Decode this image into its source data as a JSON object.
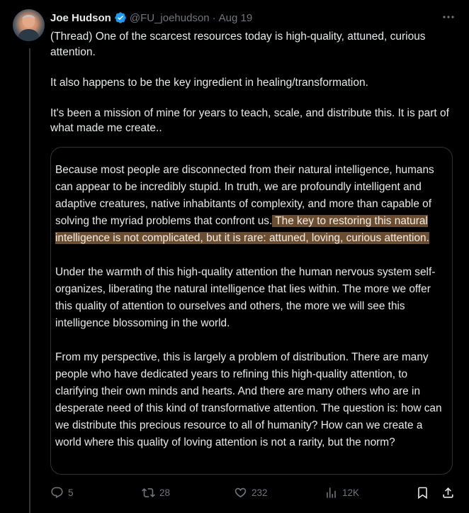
{
  "author": {
    "display_name": "Joe Hudson",
    "handle": "@FU_joehudson",
    "date": "Aug 19",
    "separator": "·"
  },
  "tweet": {
    "paragraphs": [
      "(Thread) One of the scarcest resources today is high-quality, attuned, curious attention.",
      "It also happens to be the key ingredient in healing/transformation.",
      "It's been a mission of mine for years to teach, scale, and distribute this. It is part of what made me create.."
    ]
  },
  "quote": {
    "p1_plain": "Because most people are disconnected from their natural intelligence, humans can appear to be incredibly stupid. In truth, we are profoundly intelligent and adaptive creatures, native inhabitants of complexity, and more than capable of solving the myriad problems that confront us.",
    "p1_highlight": " The key to restoring this natural intelligence is not complicated, but it is rare: attuned, loving, curious attention.",
    "p2": "Under the warmth of this high-quality attention the human nervous system self-organizes, liberating the natural intelligence that lies within. The more we offer this quality of attention to ourselves and others, the more we will see this intelligence blossoming in the world.",
    "p3": "From my perspective, this is largely a problem of distribution. There are many people who have dedicated years to refining this high-quality attention, to clarifying their own minds and hearts. And there are many others who are in desperate need of this kind of transformative attention. The question is: how can we distribute this precious resource to all of humanity? How can we create a world where this quality of loving attention is not a rarity, but the norm?",
    "highlight_color": "#6b4e32"
  },
  "actions": {
    "replies": "5",
    "reposts": "28",
    "likes": "232",
    "views": "12K"
  },
  "icons": [
    "verified-badge-icon",
    "more-icon",
    "reply-icon",
    "repost-icon",
    "like-icon",
    "views-icon",
    "bookmark-icon",
    "share-icon"
  ],
  "colors": {
    "background": "#000000",
    "text": "#e7e9ea",
    "secondary": "#71767b",
    "verified": "#1d9bf0"
  }
}
